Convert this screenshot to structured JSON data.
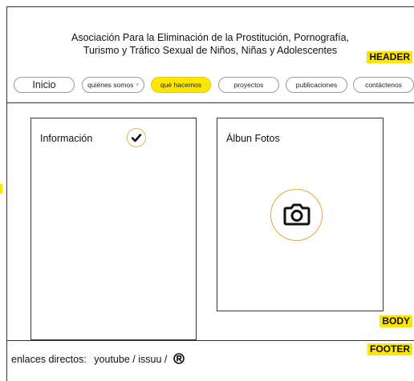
{
  "header": {
    "org_line1": "Asociación Para la Eliminación de la Prostitución, Pornografía,",
    "org_line2": "Turismo y Tráfico Sexual de Niños, Niñas y Adolescentes",
    "tag": "HEADER"
  },
  "nav": {
    "items": [
      {
        "label": "Inicio"
      },
      {
        "label": "quiénes somos",
        "icon": "chevron-down-icon"
      },
      {
        "label": "qué hacemos",
        "active": true
      },
      {
        "label": "proyectos"
      },
      {
        "label": "publicaciones"
      },
      {
        "label": "contáctenos"
      }
    ]
  },
  "body": {
    "tag": "BODY",
    "info_panel": {
      "label": "Información",
      "icon": "check-icon"
    },
    "photos_panel": {
      "label": "Álbun Fotos",
      "icon": "camera-icon"
    }
  },
  "footer": {
    "tag": "FOOTER",
    "prefix": "enlaces directos:",
    "youtube": "youtube",
    "sep1": "/",
    "issuu": "issuu",
    "sep2": "/",
    "icon": "registered-icon"
  },
  "colors": {
    "accent": "#ffe600",
    "icon_ring": "#e2a53c",
    "border": "#333333"
  }
}
